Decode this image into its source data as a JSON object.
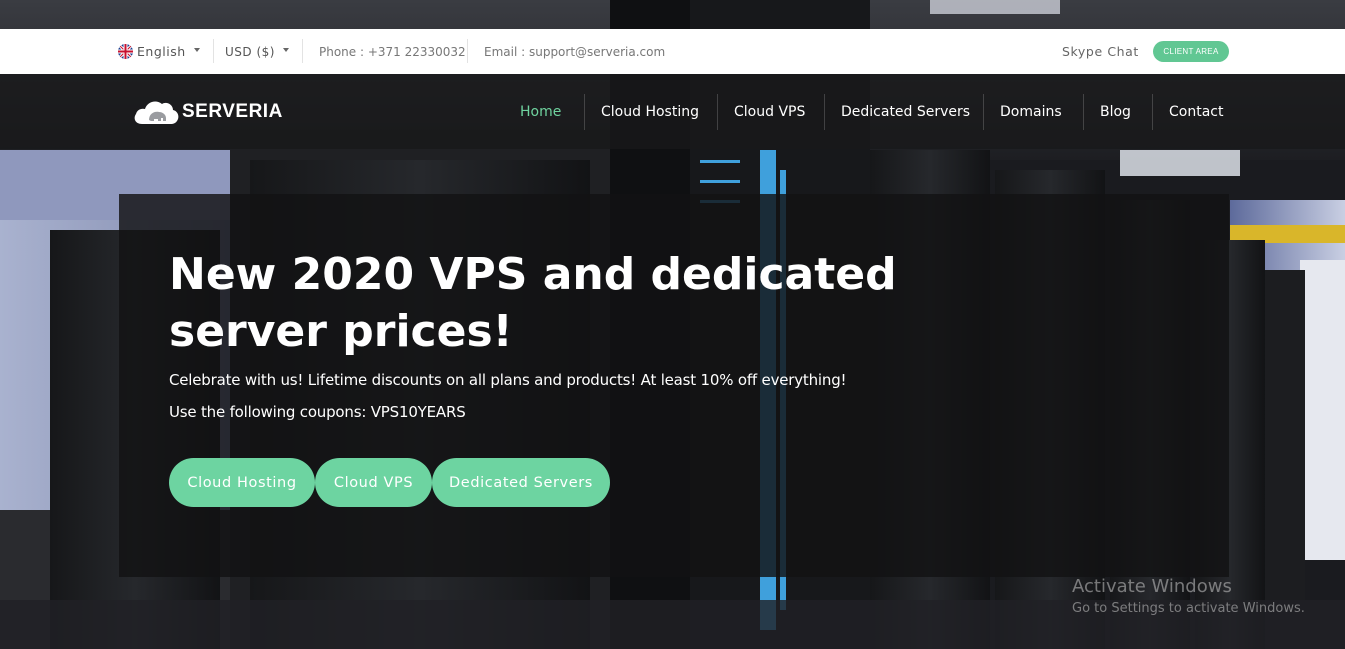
{
  "topbar": {
    "language": "English",
    "currency": "USD ($)",
    "phone": "Phone : +371 22330032",
    "email": "Email : support@serveria.com",
    "skype": "Skype Chat",
    "client_area": "CLIENT AREA"
  },
  "brand": {
    "name": "SERVERIA",
    "accent_color": "#6dd4a1"
  },
  "nav": {
    "items": [
      {
        "label": "Home",
        "active": true
      },
      {
        "label": "Cloud Hosting",
        "active": false
      },
      {
        "label": "Cloud VPS",
        "active": false
      },
      {
        "label": "Dedicated Servers",
        "active": false
      },
      {
        "label": "Domains",
        "active": false
      },
      {
        "label": "Blog",
        "active": false
      },
      {
        "label": "Contact",
        "active": false
      }
    ]
  },
  "hero": {
    "title": "New 2020 VPS and dedicated server prices!",
    "line1": "Celebrate with us! Lifetime discounts on all plans and products! At least 10% off everything!",
    "line2": "Use the following coupons: VPS10YEARS",
    "buttons": [
      "Cloud Hosting",
      "Cloud VPS",
      "Dedicated Servers"
    ]
  },
  "watermark": {
    "title": "Activate Windows",
    "subtitle": "Go to Settings to activate Windows."
  }
}
